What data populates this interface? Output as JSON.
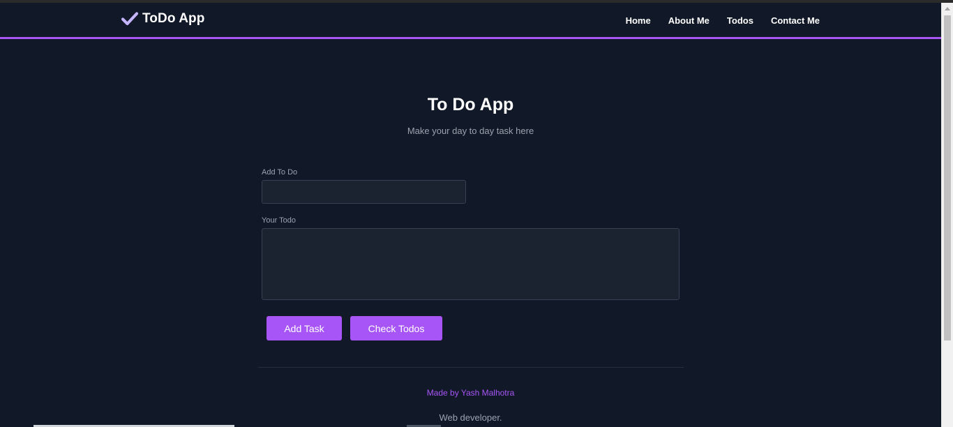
{
  "navbar": {
    "brand": {
      "icon": "check-icon",
      "label": "ToDo App"
    },
    "links": [
      {
        "label": "Home"
      },
      {
        "label": "About Me"
      },
      {
        "label": "Todos"
      },
      {
        "label": "Contact Me"
      }
    ]
  },
  "hero": {
    "title": "To Do App",
    "subtitle": "Make your day to day task here"
  },
  "form": {
    "todo_title": {
      "label": "Add To Do",
      "value": "",
      "placeholder": ""
    },
    "todo_desc": {
      "label": "Your Todo",
      "value": "",
      "placeholder": ""
    },
    "buttons": {
      "add": "Add Task",
      "check": "Check Todos"
    }
  },
  "footer": {
    "author": "Made by Yash Malhotra",
    "role": "Web developer."
  },
  "colors": {
    "background": "#111827",
    "accent": "#a855f7",
    "muted_text": "#9ca3af"
  }
}
